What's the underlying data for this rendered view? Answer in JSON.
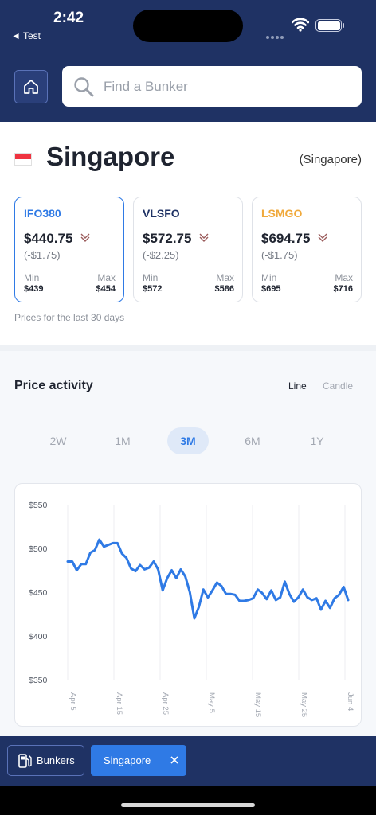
{
  "status_bar": {
    "time": "2:42",
    "back_label": "◄ Test"
  },
  "search": {
    "placeholder": "Find a Bunker"
  },
  "location": {
    "city": "Singapore",
    "region": "(Singapore)"
  },
  "cards": [
    {
      "name": "IFO380",
      "price": "$440.75",
      "change": "(-$1.75)",
      "min_label": "Min",
      "max_label": "Max",
      "min": "$439",
      "max": "$454",
      "color": "#2f7ae5",
      "active": true
    },
    {
      "name": "VLSFO",
      "price": "$572.75",
      "change": "(-$2.25)",
      "min_label": "Min",
      "max_label": "Max",
      "min": "$572",
      "max": "$586",
      "color": "#1f3264",
      "active": false
    },
    {
      "name": "LSMGO",
      "price": "$694.75",
      "change": "(-$1.75)",
      "min_label": "Min",
      "max_label": "Max",
      "min": "$695",
      "max": "$716",
      "color": "#f0a93b",
      "active": false
    }
  ],
  "price_note": "Prices for the last 30 days",
  "activity": {
    "title": "Price activity",
    "toggle_line": "Line",
    "toggle_candle": "Candle",
    "periods": [
      "2W",
      "1M",
      "3M",
      "6M",
      "1Y"
    ],
    "active_period": "3M"
  },
  "chart_data": {
    "type": "line",
    "ylim": [
      350,
      550
    ],
    "yticks": [
      550,
      500,
      450,
      400,
      350
    ],
    "ytick_labels": [
      "$550",
      "$500",
      "$450",
      "$400",
      "$350"
    ],
    "xtick_labels": [
      "Apr 5",
      "Apr 15",
      "Apr 25",
      "May 5",
      "May 15",
      "May 25",
      "Jun 4"
    ],
    "grid": true,
    "series": [
      {
        "color": "#2f7ae5",
        "values": [
          485,
          485,
          475,
          482,
          482,
          495,
          498,
          510,
          502,
          504,
          506,
          506,
          494,
          489,
          477,
          474,
          481,
          476,
          478,
          485,
          476,
          452,
          466,
          475,
          466,
          476,
          468,
          450,
          420,
          433,
          453,
          444,
          452,
          461,
          457,
          448,
          448,
          447,
          440,
          440,
          441,
          443,
          453,
          449,
          442,
          452,
          441,
          444,
          462,
          448,
          439,
          444,
          453,
          444,
          441,
          443,
          430,
          440,
          432,
          443,
          447,
          456,
          441
        ]
      }
    ]
  },
  "bottom_bar": {
    "bunkers_label": "Bunkers",
    "tab_label": "Singapore"
  }
}
